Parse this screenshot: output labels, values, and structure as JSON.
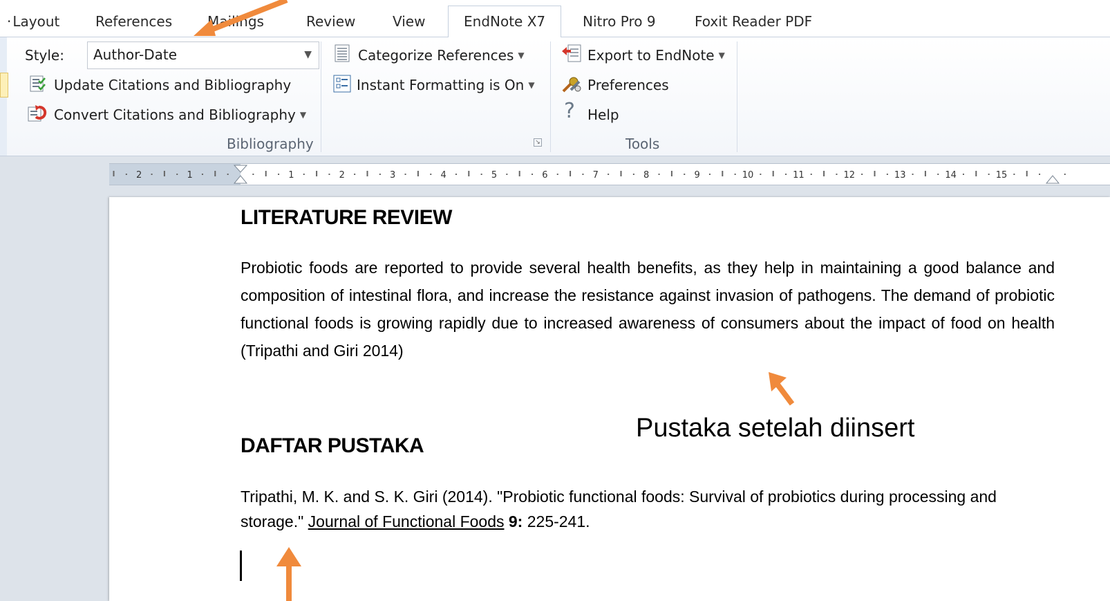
{
  "tabs": {
    "layout": "Layout",
    "references": "References",
    "mailings": "Mailings",
    "review": "Review",
    "view": "View",
    "endnote": "EndNote X7",
    "nitro": "Nitro Pro 9",
    "foxit": "Foxit Reader PDF"
  },
  "ribbon": {
    "style_label": "Style:",
    "style_value": "Author-Date",
    "update": "Update Citations and Bibliography",
    "convert": "Convert Citations and Bibliography",
    "categorize": "Categorize References",
    "instant": "Instant Formatting is On",
    "export": "Export to EndNote",
    "preferences": "Preferences",
    "help": "Help",
    "group_bibliography": "Bibliography",
    "group_tools": "Tools"
  },
  "ruler": {
    "ticks": [
      "2",
      "1",
      "1",
      "2",
      "3",
      "4",
      "5",
      "6",
      "7",
      "8",
      "9",
      "10",
      "11",
      "12",
      "13",
      "14",
      "15"
    ]
  },
  "document": {
    "heading1": "LITERATURE REVIEW",
    "para1": "Probiotic foods are reported to provide several health benefits, as they help in maintaining a good balance and composition of intestinal flora, and increase the resistance against invasion of pathogens. The demand of probiotic functional foods is growing rapidly due to increased awareness of consumers about the impact of food on health",
    "citation": "(Tripathi and Giri 2014)",
    "heading2": "DAFTAR PUSTAKA",
    "ref_authors": "Tripathi, M. K. and S. K. Giri (2014).  \"Probiotic functional foods: Survival of probiotics during processing and storage.\"",
    "ref_journal": "Journal of Functional Foods",
    "ref_volume": "9:",
    "ref_pages": "225-241."
  },
  "annotation": {
    "text": "Pustaka setelah diinsert",
    "arrow_color": "#f08a3c"
  },
  "colors": {
    "ribbon_border": "#c5cfdd",
    "workspace": "#dde3ea",
    "accent_orange": "#f08a3c"
  }
}
